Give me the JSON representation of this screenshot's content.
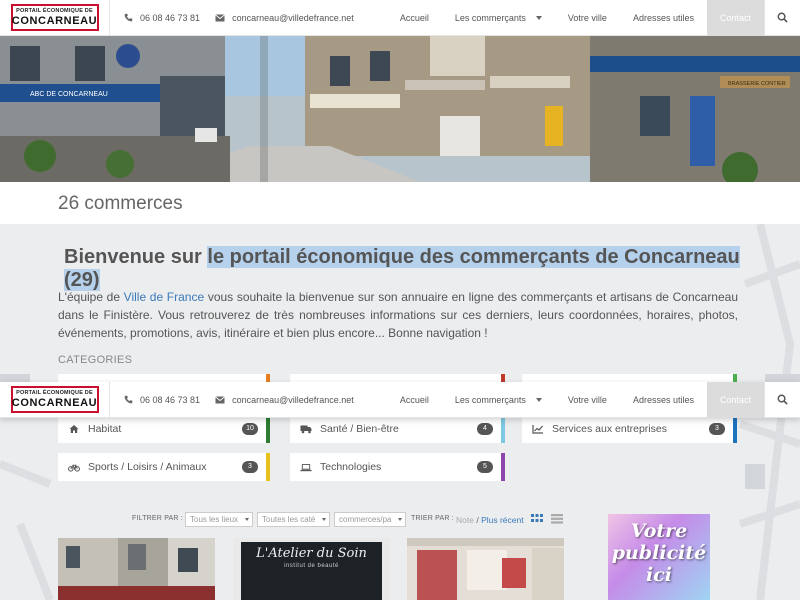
{
  "logo": {
    "top_line": "PORTAIL ÉCONOMIQUE DE",
    "main": "CONCARNEAU"
  },
  "contact": {
    "phone": "06 08 46 73 81",
    "email": "concarneau@villedefrance.net"
  },
  "menu": {
    "home": "Accueil",
    "merchants": "Les commerçants",
    "city": "Votre ville",
    "addresses": "Adresses utiles",
    "contact": "Contact"
  },
  "hero": {
    "shop_sign_left": "ABC DE CONCARNEAU",
    "shop_sign_right": "BRASSERIE CONTIER"
  },
  "count_title": "26 commerces",
  "welcome": {
    "prefix": "Bienvenue sur ",
    "highlight": "le portail économique des commerçants de Concarneau (29)"
  },
  "intro": {
    "before_link": "L'équipe de ",
    "link": "Ville de France",
    "after_link": " vous souhaite la bienvenue sur son annuaire en ligne des commerçants et artisans de Concarneau dans le Finistère. Vous retrouverez de très nombreuses informations sur ces derniers, leurs coordonnées, horaires, photos, événements, promotions, avis, itinéraire et bien plus encore... Bonne navigation !"
  },
  "categories_label": "CATEGORIES",
  "categories": [
    {
      "label": "Habitat",
      "count": "10",
      "icon": "home-icon",
      "color": "#2e7d32"
    },
    {
      "label": "Santé / Bien-être",
      "count": "4",
      "icon": "truck-icon",
      "color": "#7ec8e3"
    },
    {
      "label": "Services aux entreprises",
      "count": "3",
      "icon": "chart-line-icon",
      "color": "#1e73be"
    },
    {
      "label": "Sports / Loisirs / Animaux",
      "count": "3",
      "icon": "bicycle-icon",
      "color": "#e8c21c"
    },
    {
      "label": "Technologies",
      "count": "5",
      "icon": "laptop-icon",
      "color": "#8e44ad"
    }
  ],
  "partial_category_colors": [
    "#e67e22",
    "#c0392b",
    "#4caf50"
  ],
  "filters": {
    "filter_label": "FILTRER PAR :",
    "places": "Tous les lieux",
    "categories": "Toutes les caté",
    "per_page": "commerces/pa",
    "sort_label": "TRIER PAR :",
    "sort_note": "Note",
    "sort_separator": " / ",
    "sort_recent": "Plus récent"
  },
  "cards": {
    "atelier_title": "L'Atelier du Soin",
    "atelier_sub": "institut de beauté"
  },
  "ad": {
    "line1": "Votre",
    "line2": "publicité",
    "line3": "ici"
  },
  "colors": {
    "accent_link": "#3a7ab8",
    "highlight": "#b6d1ec",
    "logo_red": "#c8102e",
    "contact_bg": "#dcdcdc"
  }
}
